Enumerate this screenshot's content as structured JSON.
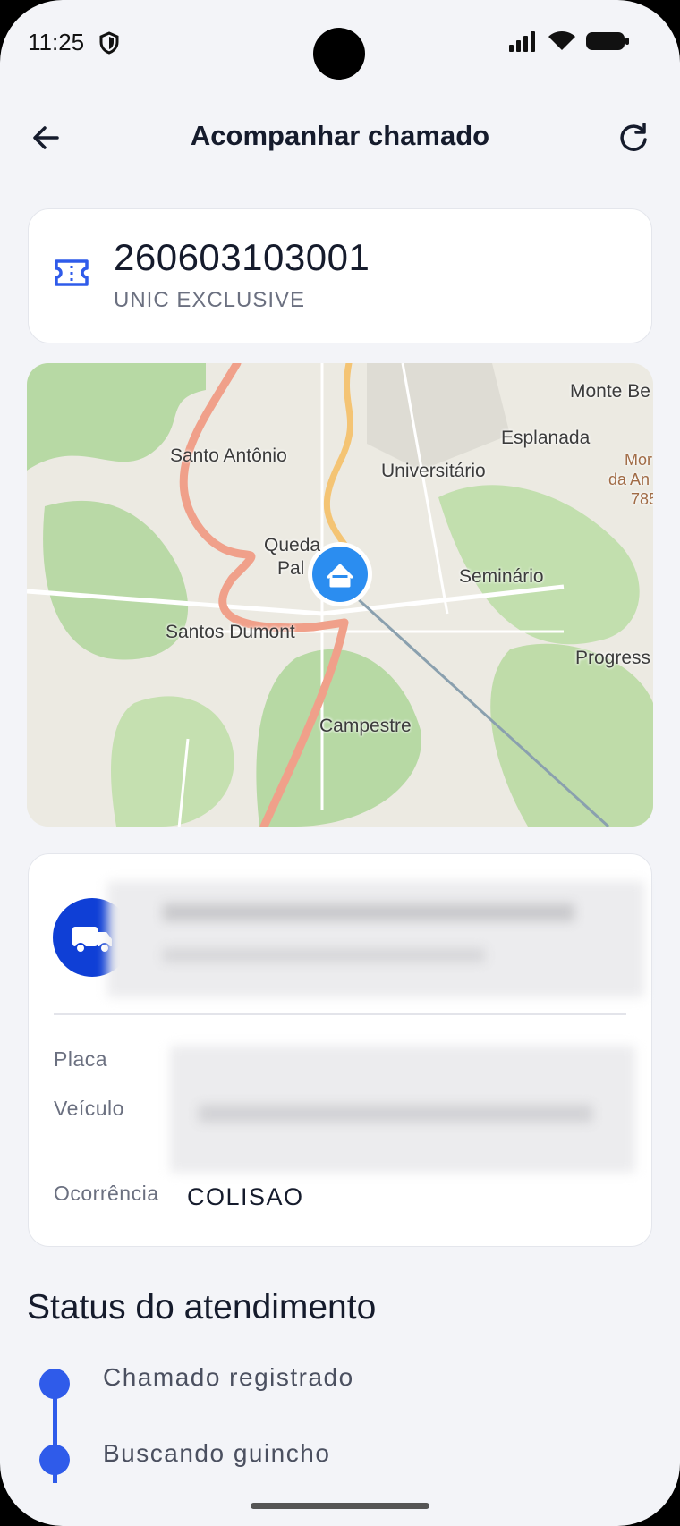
{
  "status_bar": {
    "time": "11:25"
  },
  "header": {
    "title": "Acompanhar chamado"
  },
  "ticket": {
    "number": "260603103001",
    "plan": "UNIC EXCLUSIVE"
  },
  "map": {
    "labels": {
      "santo_antonio": "Santo Antônio",
      "universitario": "Universitário",
      "esplanada": "Esplanada",
      "monte": "Monte Be",
      "museu1": "Mor",
      "museu2": "da An",
      "museu3": "785",
      "queda1": "Queda",
      "queda2": "Pal",
      "seminario": "Seminário",
      "santos_dumont": "Santos Dumont",
      "progress": "Progress",
      "campestre": "Campestre"
    }
  },
  "vehicle": {
    "placa_label": "Placa",
    "veiculo_label": "Veículo",
    "ocorrencia_label": "Ocorrência",
    "ocorrencia_value": "COLISAO"
  },
  "status": {
    "title": "Status do atendimento",
    "steps": [
      "Chamado registrado",
      "Buscando guincho"
    ]
  },
  "colors": {
    "accent": "#2f5bea",
    "truck_bg": "#0f3fd6",
    "route": "#f0a08a"
  }
}
